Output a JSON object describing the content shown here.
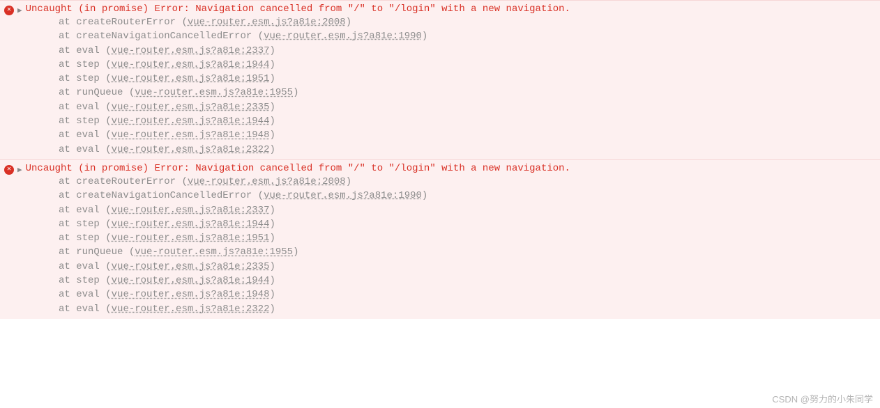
{
  "errors": [
    {
      "message": "Uncaught (in promise) Error: Navigation cancelled from \"/\" to \"/login\" with a new navigation.",
      "stack": [
        {
          "fn": "createRouterError",
          "file": "vue-router.esm.js?a81e:2008"
        },
        {
          "fn": "createNavigationCancelledError",
          "file": "vue-router.esm.js?a81e:1990"
        },
        {
          "fn": "eval",
          "file": "vue-router.esm.js?a81e:2337"
        },
        {
          "fn": "step",
          "file": "vue-router.esm.js?a81e:1944"
        },
        {
          "fn": "step",
          "file": "vue-router.esm.js?a81e:1951"
        },
        {
          "fn": "runQueue",
          "file": "vue-router.esm.js?a81e:1955"
        },
        {
          "fn": "eval",
          "file": "vue-router.esm.js?a81e:2335"
        },
        {
          "fn": "step",
          "file": "vue-router.esm.js?a81e:1944"
        },
        {
          "fn": "eval",
          "file": "vue-router.esm.js?a81e:1948"
        },
        {
          "fn": "eval",
          "file": "vue-router.esm.js?a81e:2322"
        }
      ]
    },
    {
      "message": "Uncaught (in promise) Error: Navigation cancelled from \"/\" to \"/login\" with a new navigation.",
      "stack": [
        {
          "fn": "createRouterError",
          "file": "vue-router.esm.js?a81e:2008"
        },
        {
          "fn": "createNavigationCancelledError",
          "file": "vue-router.esm.js?a81e:1990"
        },
        {
          "fn": "eval",
          "file": "vue-router.esm.js?a81e:2337"
        },
        {
          "fn": "step",
          "file": "vue-router.esm.js?a81e:1944"
        },
        {
          "fn": "step",
          "file": "vue-router.esm.js?a81e:1951"
        },
        {
          "fn": "runQueue",
          "file": "vue-router.esm.js?a81e:1955"
        },
        {
          "fn": "eval",
          "file": "vue-router.esm.js?a81e:2335"
        },
        {
          "fn": "step",
          "file": "vue-router.esm.js?a81e:1944"
        },
        {
          "fn": "eval",
          "file": "vue-router.esm.js?a81e:1948"
        },
        {
          "fn": "eval",
          "file": "vue-router.esm.js?a81e:2322"
        }
      ]
    }
  ],
  "watermark": "CSDN @努力的小朱同学",
  "at_prefix": "at "
}
